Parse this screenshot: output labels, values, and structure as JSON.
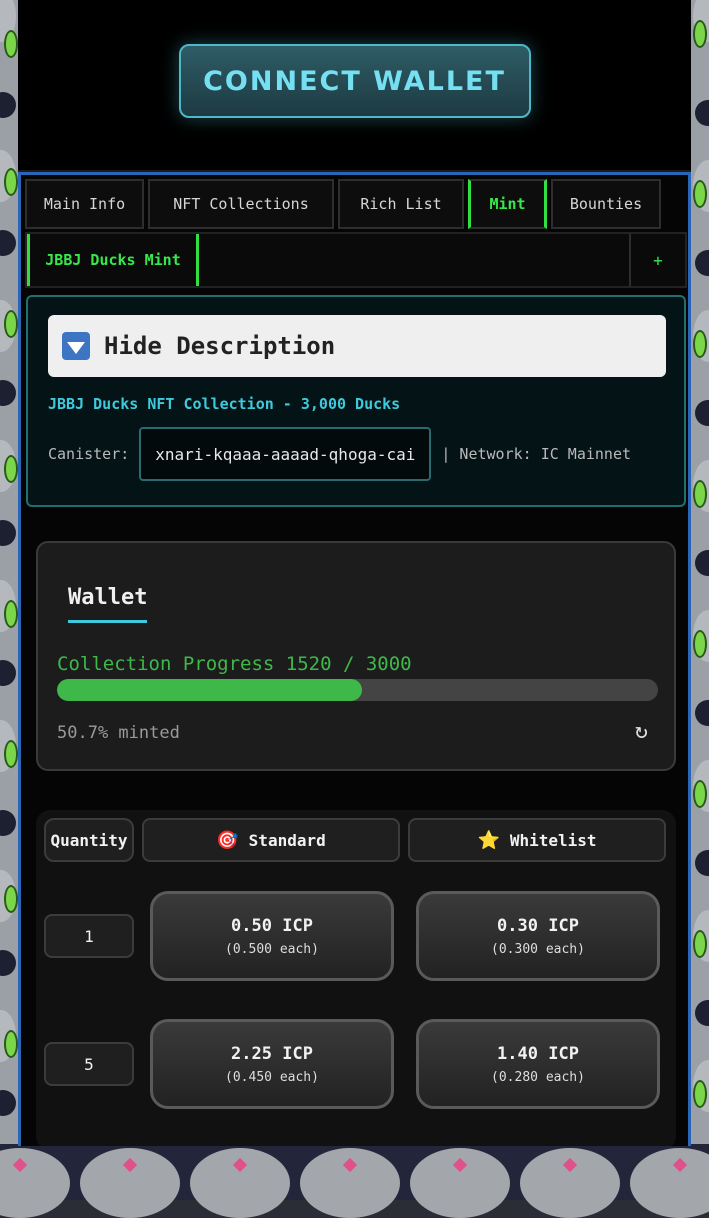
{
  "header": {
    "connect_label": "CONNECT WALLET"
  },
  "tabs": [
    {
      "label": "Main Info",
      "active": false
    },
    {
      "label": "NFT Collections",
      "active": false
    },
    {
      "label": "Rich List",
      "active": false
    },
    {
      "label": "Mint",
      "active": true
    },
    {
      "label": "Bounties",
      "active": false
    }
  ],
  "subtabs": {
    "active_label": "JBBJ Ducks Mint",
    "add_label": "+"
  },
  "description": {
    "toggle_label": "Hide Description",
    "collection_title": "JBBJ Ducks NFT Collection - 3,000 Ducks",
    "canister_label": "Canister:",
    "canister_id": "xnari-kqaaa-aaaad-qhoga-cai",
    "network_text": "| Network: IC Mainnet"
  },
  "wallet": {
    "title": "Wallet",
    "progress_label": "Collection Progress 1520 / 3000",
    "progress_fraction": 0.507,
    "minted_text": "50.7% minted",
    "refresh_icon": "↻"
  },
  "pricing": {
    "quantity_header": "Quantity",
    "standard_header": "Standard",
    "standard_icon": "🎯",
    "whitelist_header": "Whitelist",
    "whitelist_icon": "⭐",
    "rows": [
      {
        "qty": "1",
        "standard_price": "0.50 ICP",
        "standard_each": "(0.500 each)",
        "whitelist_price": "0.30 ICP",
        "whitelist_each": "(0.300 each)"
      },
      {
        "qty": "5",
        "standard_price": "2.25 ICP",
        "standard_each": "(0.450 each)",
        "whitelist_price": "1.40 ICP",
        "whitelist_each": "(0.280 each)"
      }
    ]
  },
  "colors": {
    "accent_cyan": "#3ec9dc",
    "accent_green": "#36e84a",
    "progress_green": "#3fb84a",
    "panel_border": "#2a66b8"
  }
}
